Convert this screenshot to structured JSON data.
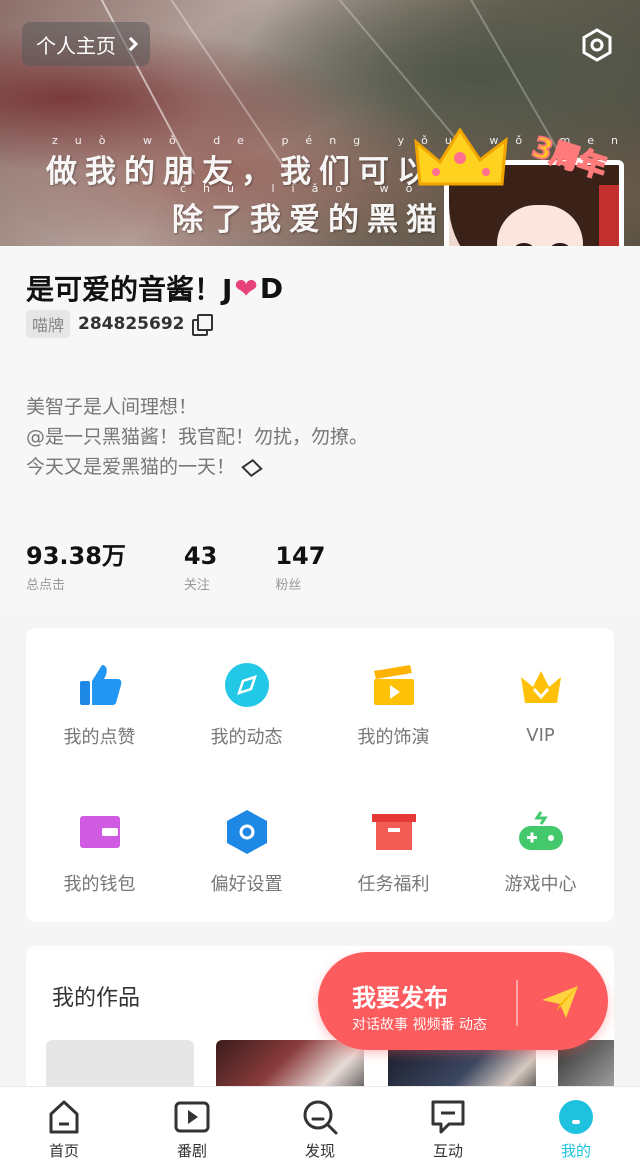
{
  "header": {
    "profile_home_label": "个人主页",
    "banner_line1": "做我的朋友，我们可以分享一切",
    "banner_line2": "除了我爱的黑猫",
    "banner_pinyin1": "zuò wǒ de péng yǒu wǒ men kě yǐ fēn xiǎng yī qiè",
    "banner_pinyin2": "chú liǎo wǒ ài de"
  },
  "avatar": {
    "anniversary_text": "3周年",
    "gender_symbol": "♀"
  },
  "profile": {
    "nickname_prefix": "是可爱的音酱！J",
    "nickname_heart": "❤",
    "nickname_suffix": "D",
    "id_tag": "喵牌",
    "id_number": "284825692",
    "bio": [
      "美智子是人间理想！",
      "@是一只黑猫酱！我官配！勿扰，勿撩。",
      "今天又是爱黑猫的一天！"
    ]
  },
  "stats": [
    {
      "value": "93.38万",
      "label": "总点击"
    },
    {
      "value": "43",
      "label": "关注"
    },
    {
      "value": "147",
      "label": "粉丝"
    }
  ],
  "menu": [
    {
      "label": "我的点赞",
      "icon": "thumbs-up-icon",
      "color": "#2196f3"
    },
    {
      "label": "我的动态",
      "icon": "compass-icon",
      "color": "#22c8e5"
    },
    {
      "label": "我的饰演",
      "icon": "clapperboard-icon",
      "color": "#ffc107"
    },
    {
      "label": "VIP",
      "icon": "crown-icon",
      "color": "#ffc107"
    },
    {
      "label": "我的钱包",
      "icon": "wallet-icon",
      "color": "#d05ce3"
    },
    {
      "label": "偏好设置",
      "icon": "hexagon-settings-icon",
      "color": "#1e88e5"
    },
    {
      "label": "任务福利",
      "icon": "gift-box-icon",
      "color": "#f44336"
    },
    {
      "label": "游戏中心",
      "icon": "gamepad-icon",
      "color": "#43c96b"
    }
  ],
  "works": {
    "title": "我的作品"
  },
  "publish": {
    "title": "我要发布",
    "subtitle": "对话故事 视频番 动态"
  },
  "nav": [
    {
      "label": "首页",
      "icon": "home-icon"
    },
    {
      "label": "番剧",
      "icon": "play-icon"
    },
    {
      "label": "发现",
      "icon": "discover-search-icon"
    },
    {
      "label": "互动",
      "icon": "chat-icon"
    },
    {
      "label": "我的",
      "icon": "profile-icon",
      "active": true
    }
  ],
  "colors": {
    "accent": "#1fc2de",
    "publish": "#fd5c5f"
  }
}
